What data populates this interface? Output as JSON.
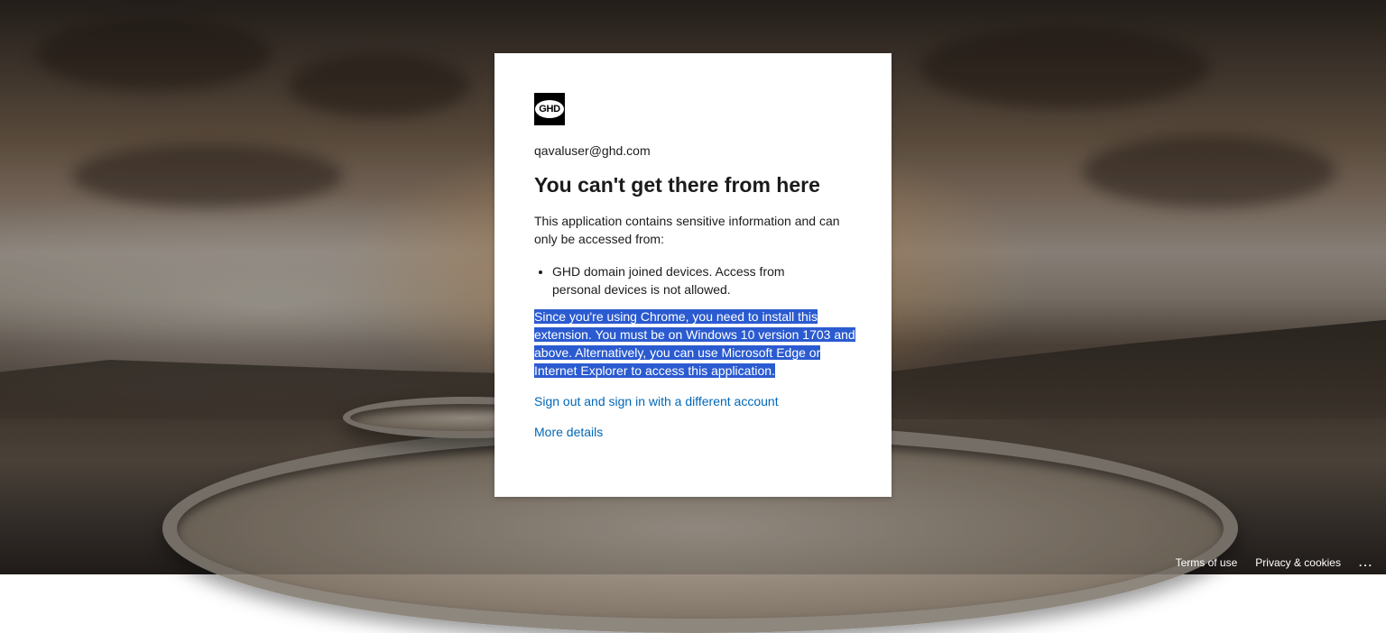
{
  "account": {
    "email": "qavaluser@ghd.com"
  },
  "logo": {
    "text": "GHD"
  },
  "message": {
    "title": "You can't get there from here",
    "description": "This application contains sensitive information and can only be accessed from:",
    "bullets": [
      "GHD domain joined devices. Access from personal devices is not allowed."
    ],
    "selected_text": "Since you're using Chrome, you need to install this extension. You must be on Windows 10 version 1703 and above. Alternatively, you can use Microsoft Edge or Internet Explorer to access this application."
  },
  "links": {
    "sign_out": "Sign out and sign in with a different account",
    "more_details": "More details"
  },
  "footer": {
    "terms": "Terms of use",
    "privacy": "Privacy & cookies",
    "more": "..."
  },
  "colors": {
    "link": "#0067b8",
    "selection": "#2b5bd0",
    "card": "#ffffff"
  }
}
